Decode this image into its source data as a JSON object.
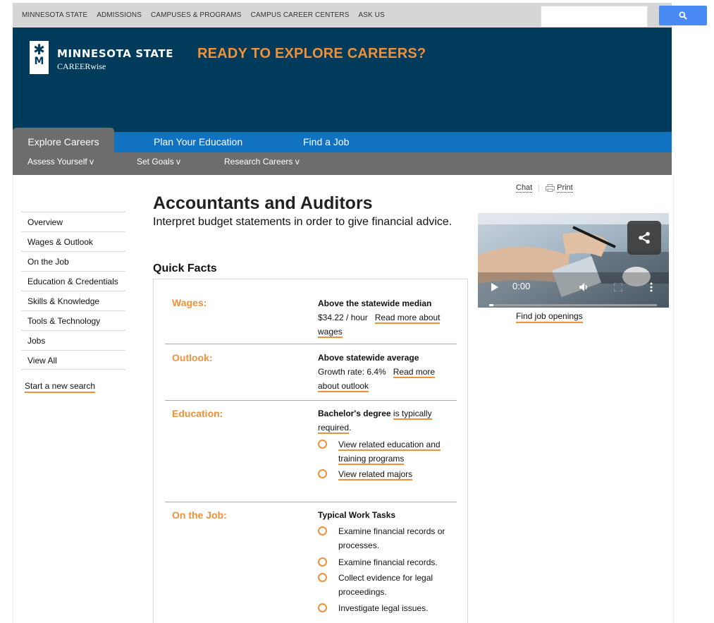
{
  "topbar": {
    "links": [
      "MINNESOTA STATE",
      "ADMISSIONS",
      "CAMPUSES & PROGRAMS",
      "CAMPUS CAREER CENTERS",
      "ASK US"
    ],
    "search_value": "",
    "search_icon": "magnifier-icon"
  },
  "header": {
    "logo_name": "MINNESOTA STATE",
    "logo_sub": "CAREERwise",
    "tagline": "READY TO EXPLORE CAREERS?"
  },
  "nav": {
    "tabs": [
      "Explore Careers",
      "Plan Your Education",
      "Find a Job"
    ],
    "active": "Explore Careers",
    "sub": [
      "Assess Yourself v",
      "Set Goals v",
      "Research Careers v"
    ]
  },
  "sidebar": {
    "items": [
      "Overview",
      "Wages & Outlook",
      "On the Job",
      "Education & Credentials",
      "Skills & Knowledge",
      "Tools & Technology",
      "Jobs",
      "View All"
    ],
    "new_search": "Start a new search"
  },
  "main": {
    "title": "Accountants and Auditors",
    "description": "Interpret budget statements in order to give financial advice.",
    "quick_facts_heading": "Quick Facts",
    "wages": {
      "label": "Wages:",
      "headline": "Above the statewide median",
      "value": "$34.22 / hour",
      "link_a": "Read more about",
      "link_b": "wages"
    },
    "outlook": {
      "label": "Outlook:",
      "headline": "Above statewide average",
      "value": "Growth rate:  6.4%",
      "link_a": "Read more",
      "link_b": "about outlook"
    },
    "education": {
      "label": "Education:",
      "degree": "Bachelor's degree",
      "typical_a": "is typically",
      "typical_b": "required",
      "period": ".",
      "links": [
        [
          "View related education and",
          "training programs"
        ],
        [
          "View related majors"
        ]
      ]
    },
    "on_the_job": {
      "label": "On the Job:",
      "heading": "Typical Work Tasks",
      "tasks": [
        [
          "Examine financial records or",
          "processes."
        ],
        [
          "Examine financial records."
        ],
        [
          "Collect evidence for legal",
          "proceedings."
        ],
        [
          "Investigate legal issues."
        ]
      ]
    }
  },
  "right": {
    "chat": "Chat",
    "print": "Print",
    "video_time": "0:00",
    "find_jobs": "Find job openings"
  },
  "colors": {
    "brand_navy": "#003b5c",
    "nav_blue": "#1172c2",
    "subnav_gray": "#6d6d6d",
    "accent_orange": "#f0913a",
    "search_blue": "#4a8af4"
  }
}
